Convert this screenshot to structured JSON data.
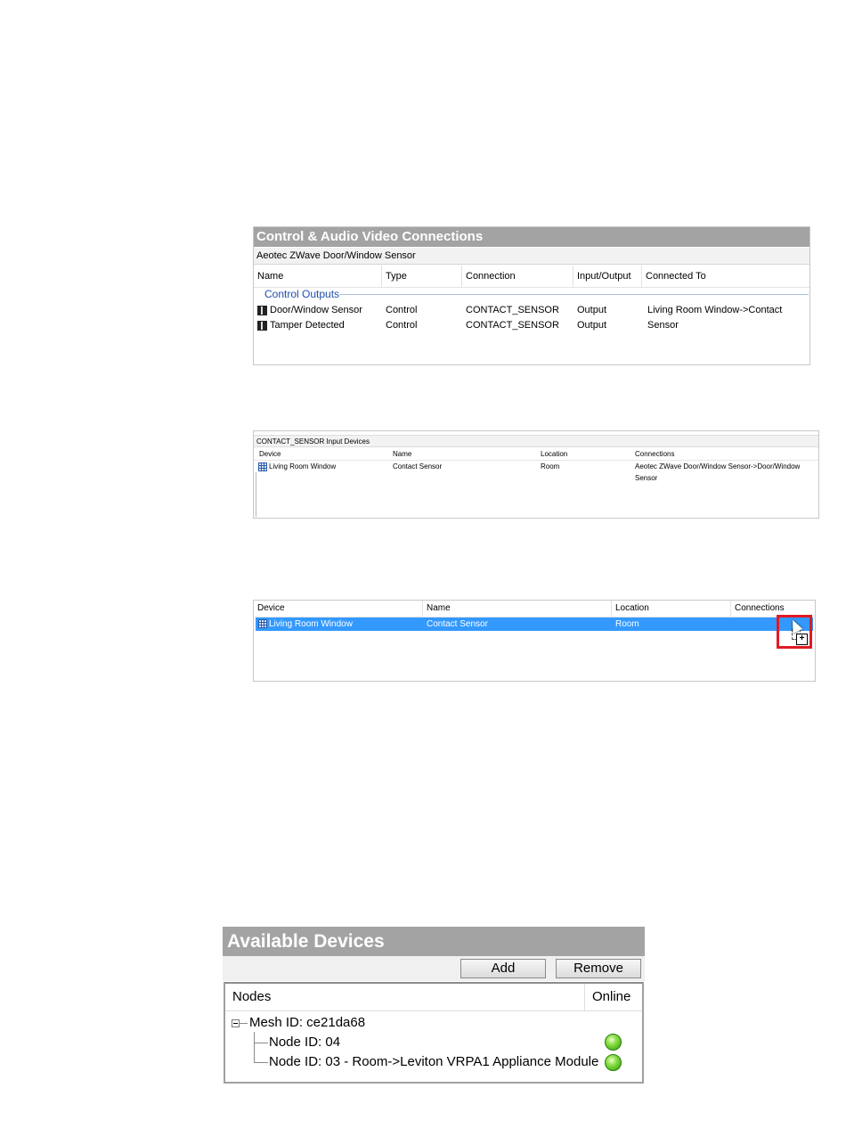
{
  "control_panel": {
    "title": "Control & Audio Video Connections",
    "device": "Aeotec ZWave Door/Window Sensor",
    "columns": [
      "Name",
      "Type",
      "Connection",
      "Input/Output",
      "Connected To"
    ],
    "group": "Control Outputs",
    "rows": [
      {
        "name": "Door/Window Sensor",
        "type": "Control",
        "connection": "CONTACT_SENSOR",
        "io": "Output",
        "connected_to": "Living Room Window->Contact Sensor"
      },
      {
        "name": "Tamper Detected",
        "type": "Control",
        "connection": "CONTACT_SENSOR",
        "io": "Output",
        "connected_to": ""
      }
    ]
  },
  "input_devices": {
    "title": "CONTACT_SENSOR Input Devices",
    "columns": [
      "Device",
      "Name",
      "Location",
      "Connections"
    ],
    "rows": [
      {
        "device": "Living Room Window",
        "name": "Contact Sensor",
        "location": "Room",
        "connections": "Aeotec ZWave Door/Window Sensor->Door/Window Sensor"
      }
    ]
  },
  "drag_panel": {
    "columns": [
      "Device",
      "Name",
      "Location",
      "Connections"
    ],
    "rows": [
      {
        "device": "Living Room Window",
        "name": "Contact Sensor",
        "location": "Room",
        "connections": ""
      }
    ],
    "highlight_color": "#e01b24",
    "selection_color": "#3399ff"
  },
  "available_devices": {
    "title": "Available Devices",
    "add_label": "Add",
    "remove_label": "Remove",
    "columns": [
      "Nodes",
      "Online"
    ],
    "mesh": "Mesh ID: ce21da68",
    "nodes": [
      {
        "label": "Node ID: 04",
        "online": true
      },
      {
        "label": "Node ID: 03 - Room->Leviton VRPA1 Appliance Module",
        "online": true
      }
    ],
    "online_color": "#4fb81b"
  }
}
